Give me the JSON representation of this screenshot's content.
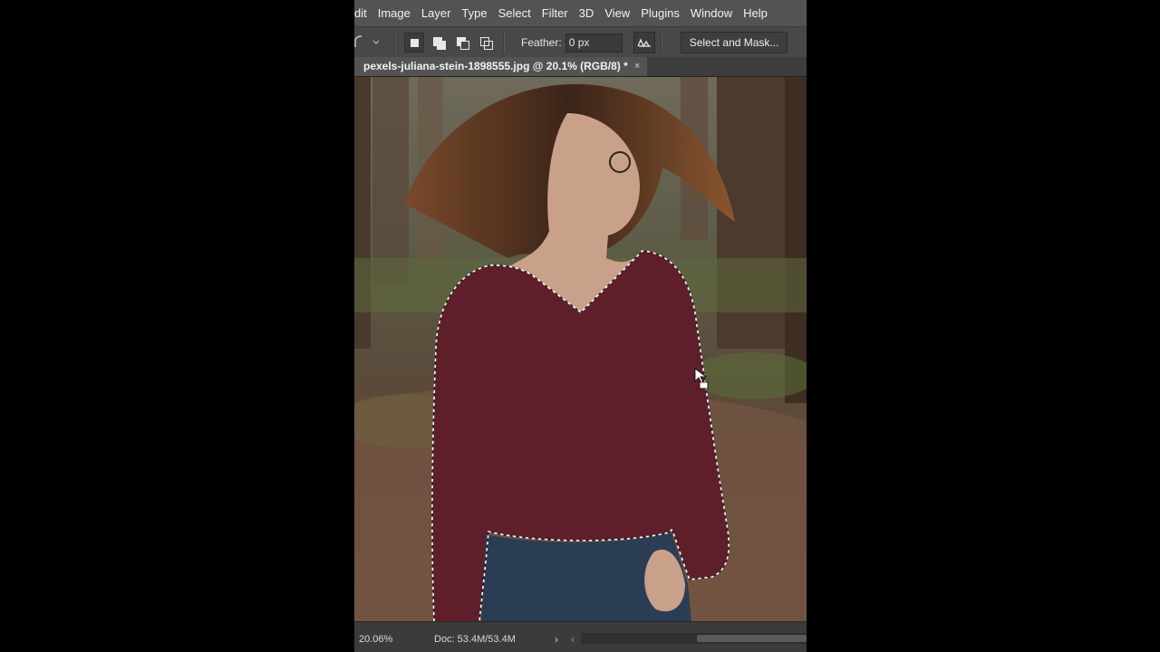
{
  "menu": [
    "dit",
    "Image",
    "Layer",
    "Type",
    "Select",
    "Filter",
    "3D",
    "View",
    "Plugins",
    "Window",
    "Help"
  ],
  "options": {
    "feather_label": "Feather:",
    "feather_value": "0 px",
    "select_and_mask": "Select and Mask..."
  },
  "document": {
    "tab_title": "pexels-juliana-stein-1898555.jpg @ 20.1% (RGB/8) *",
    "close_glyph": "×"
  },
  "status": {
    "zoom": "20.06%",
    "doc_size": "Doc: 53.4M/53.4M"
  },
  "icons": {
    "tool": "lasso-icon",
    "chevron": "chevron-down-icon",
    "new_selection": "new-selection-icon",
    "add_selection": "add-to-selection-icon",
    "subtract_selection": "subtract-from-selection-icon",
    "intersect_selection": "intersect-selection-icon",
    "anti_alias": "anti-alias-icon",
    "cursor": "cursor-icon"
  },
  "colors": {
    "menu_bg": "#535353",
    "options_bg": "#484848",
    "sweater": "#5e1f2b",
    "jeans": "#2b3d55",
    "selection_outline": "#ffffff"
  }
}
